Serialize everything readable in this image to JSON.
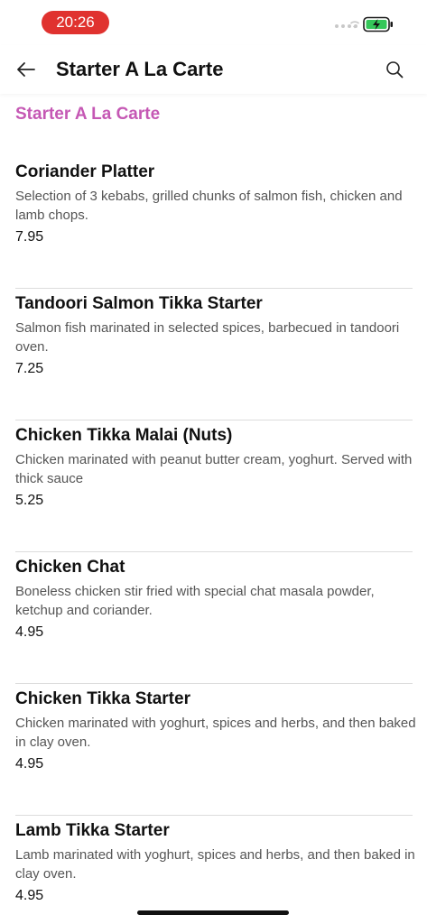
{
  "status_bar": {
    "time": "20:26",
    "time_pill_color": "#e0322f",
    "battery_color": "#34c759",
    "battery_state": "charging"
  },
  "nav": {
    "title": "Starter A La Carte",
    "back_icon": "arrow-left-icon",
    "search_icon": "search-icon"
  },
  "section": {
    "heading": "Starter A La Carte",
    "heading_color": "#c558b4"
  },
  "items": [
    {
      "name": "Coriander Platter",
      "description": "Selection of 3 kebabs, grilled chunks of salmon fish, chicken and lamb chops.",
      "price": "7.95"
    },
    {
      "name": "Tandoori Salmon Tikka Starter",
      "description": "Salmon fish marinated in selected spices, barbecued in tandoori oven.",
      "price": "7.25"
    },
    {
      "name": "Chicken Tikka Malai (Nuts)",
      "description": "Chicken marinated with peanut butter cream, yoghurt. Served with thick sauce",
      "price": "5.25"
    },
    {
      "name": "Chicken Chat",
      "description": "Boneless chicken stir fried with special chat masala powder, ketchup and coriander.",
      "price": "4.95"
    },
    {
      "name": "Chicken Tikka Starter",
      "description": "Chicken marinated with yoghurt, spices and herbs, and then baked in clay oven.",
      "price": "4.95"
    },
    {
      "name": "Lamb Tikka Starter",
      "description": "Lamb marinated with yoghurt, spices and herbs, and then baked in clay oven.",
      "price": "4.95"
    }
  ]
}
